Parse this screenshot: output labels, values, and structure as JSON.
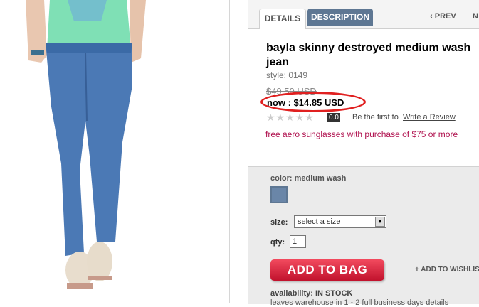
{
  "tabs": {
    "details": "DETAILS",
    "description": "DESCRIPTION"
  },
  "nav": {
    "prev": "PREV",
    "next": "N"
  },
  "product": {
    "title": "bayla skinny destroyed medium wash jean",
    "style": "style: 0149",
    "was_price": "$49.50 USD",
    "now_price": "now : $14.85 USD",
    "rating": "0.0",
    "stars": "★★★★★",
    "first_text": "Be the first to",
    "review_link": "Write a Review",
    "promo": "free aero sunglasses with purchase of $75 or more"
  },
  "options": {
    "color_label": "color: medium wash",
    "size_label": "size:",
    "size_value": "select a size",
    "qty_label": "qty:",
    "qty_value": "1",
    "add_to_bag": "ADD TO BAG",
    "wishlist": "+ ADD TO WISHLIS",
    "availability": "availability: IN STOCK",
    "leaves": "leaves warehouse in 1 - 2 full business days details"
  },
  "colors": {
    "accent_tab": "#5e7793",
    "button_red": "#d41f3a",
    "promo": "#b0124f",
    "annotation": "#e02020"
  }
}
